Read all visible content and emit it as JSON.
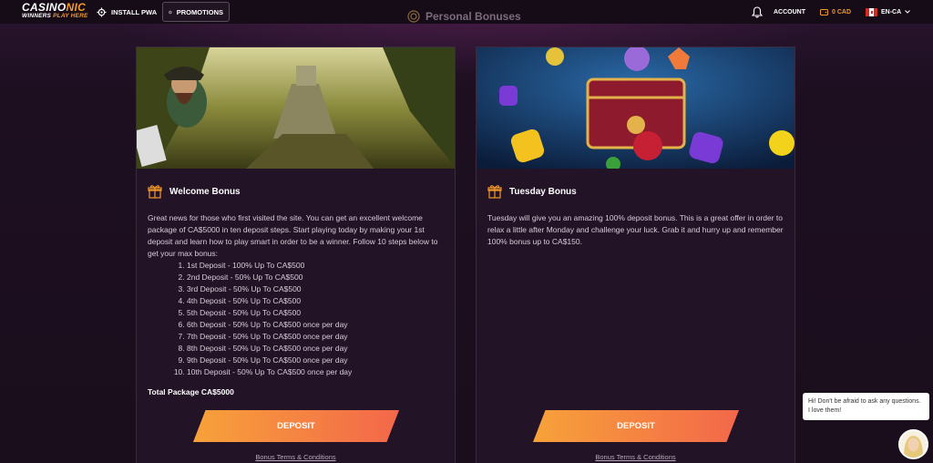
{
  "header": {
    "logo": {
      "main_a": "CASINO",
      "main_b": "NIC",
      "sub_a": "WINNERS ",
      "sub_b": "PLAY HERE"
    },
    "install_label": "INSTALL PWA",
    "promotions_label": "PROMOTIONS",
    "account_label": "ACCOUNT",
    "balance": "0 CAD",
    "language": "EN-CA"
  },
  "page": {
    "title": "Personal Bonuses"
  },
  "cards": [
    {
      "title": "Welcome Bonus",
      "intro": "Great news for those who first visited the site. You can get an excellent welcome package of CA$5000 in ten deposit steps. Start playing today by making your 1st deposit and learn how to play smart in order to be a winner. Follow 10 steps below to get your max bonus:",
      "steps": [
        "1st Deposit - 100% Up To CA$500",
        "2nd Deposit - 50% Up To CA$500",
        "3rd Deposit - 50% Up To CA$500",
        "4th Deposit - 50% Up To CA$500",
        "5th Deposit - 50% Up To CA$500",
        "6th Deposit - 50% Up To CA$500 once per day",
        "7th Deposit - 50% Up To CA$500 once per day",
        "8th Deposit - 50% Up To CA$500 once per day",
        "9th Deposit - 50% Up To CA$500 once per day",
        "10th Deposit - 50% Up To CA$500 once per day"
      ],
      "total": "Total Package CA$5000",
      "button_label": "DEPOSIT",
      "terms_label": "Bonus Terms & Conditions"
    },
    {
      "title": "Tuesday Bonus",
      "intro": "Tuesday will give you an amazing 100% deposit bonus. This is a great offer in order to relax a little after Monday and challenge your luck. Grab it and hurry up and remember 100% bonus up to CA$150.",
      "button_label": "DEPOSIT",
      "terms_label": "Bonus Terms & Conditions"
    }
  ],
  "chat": {
    "message": "Hi! Don't be afraid to ask any questions. I love them!"
  },
  "colors": {
    "accent": "#f39a2a",
    "button_start": "#f7a23a",
    "button_end": "#f3674a",
    "background": "#1b0f1d",
    "card": "#221326"
  }
}
